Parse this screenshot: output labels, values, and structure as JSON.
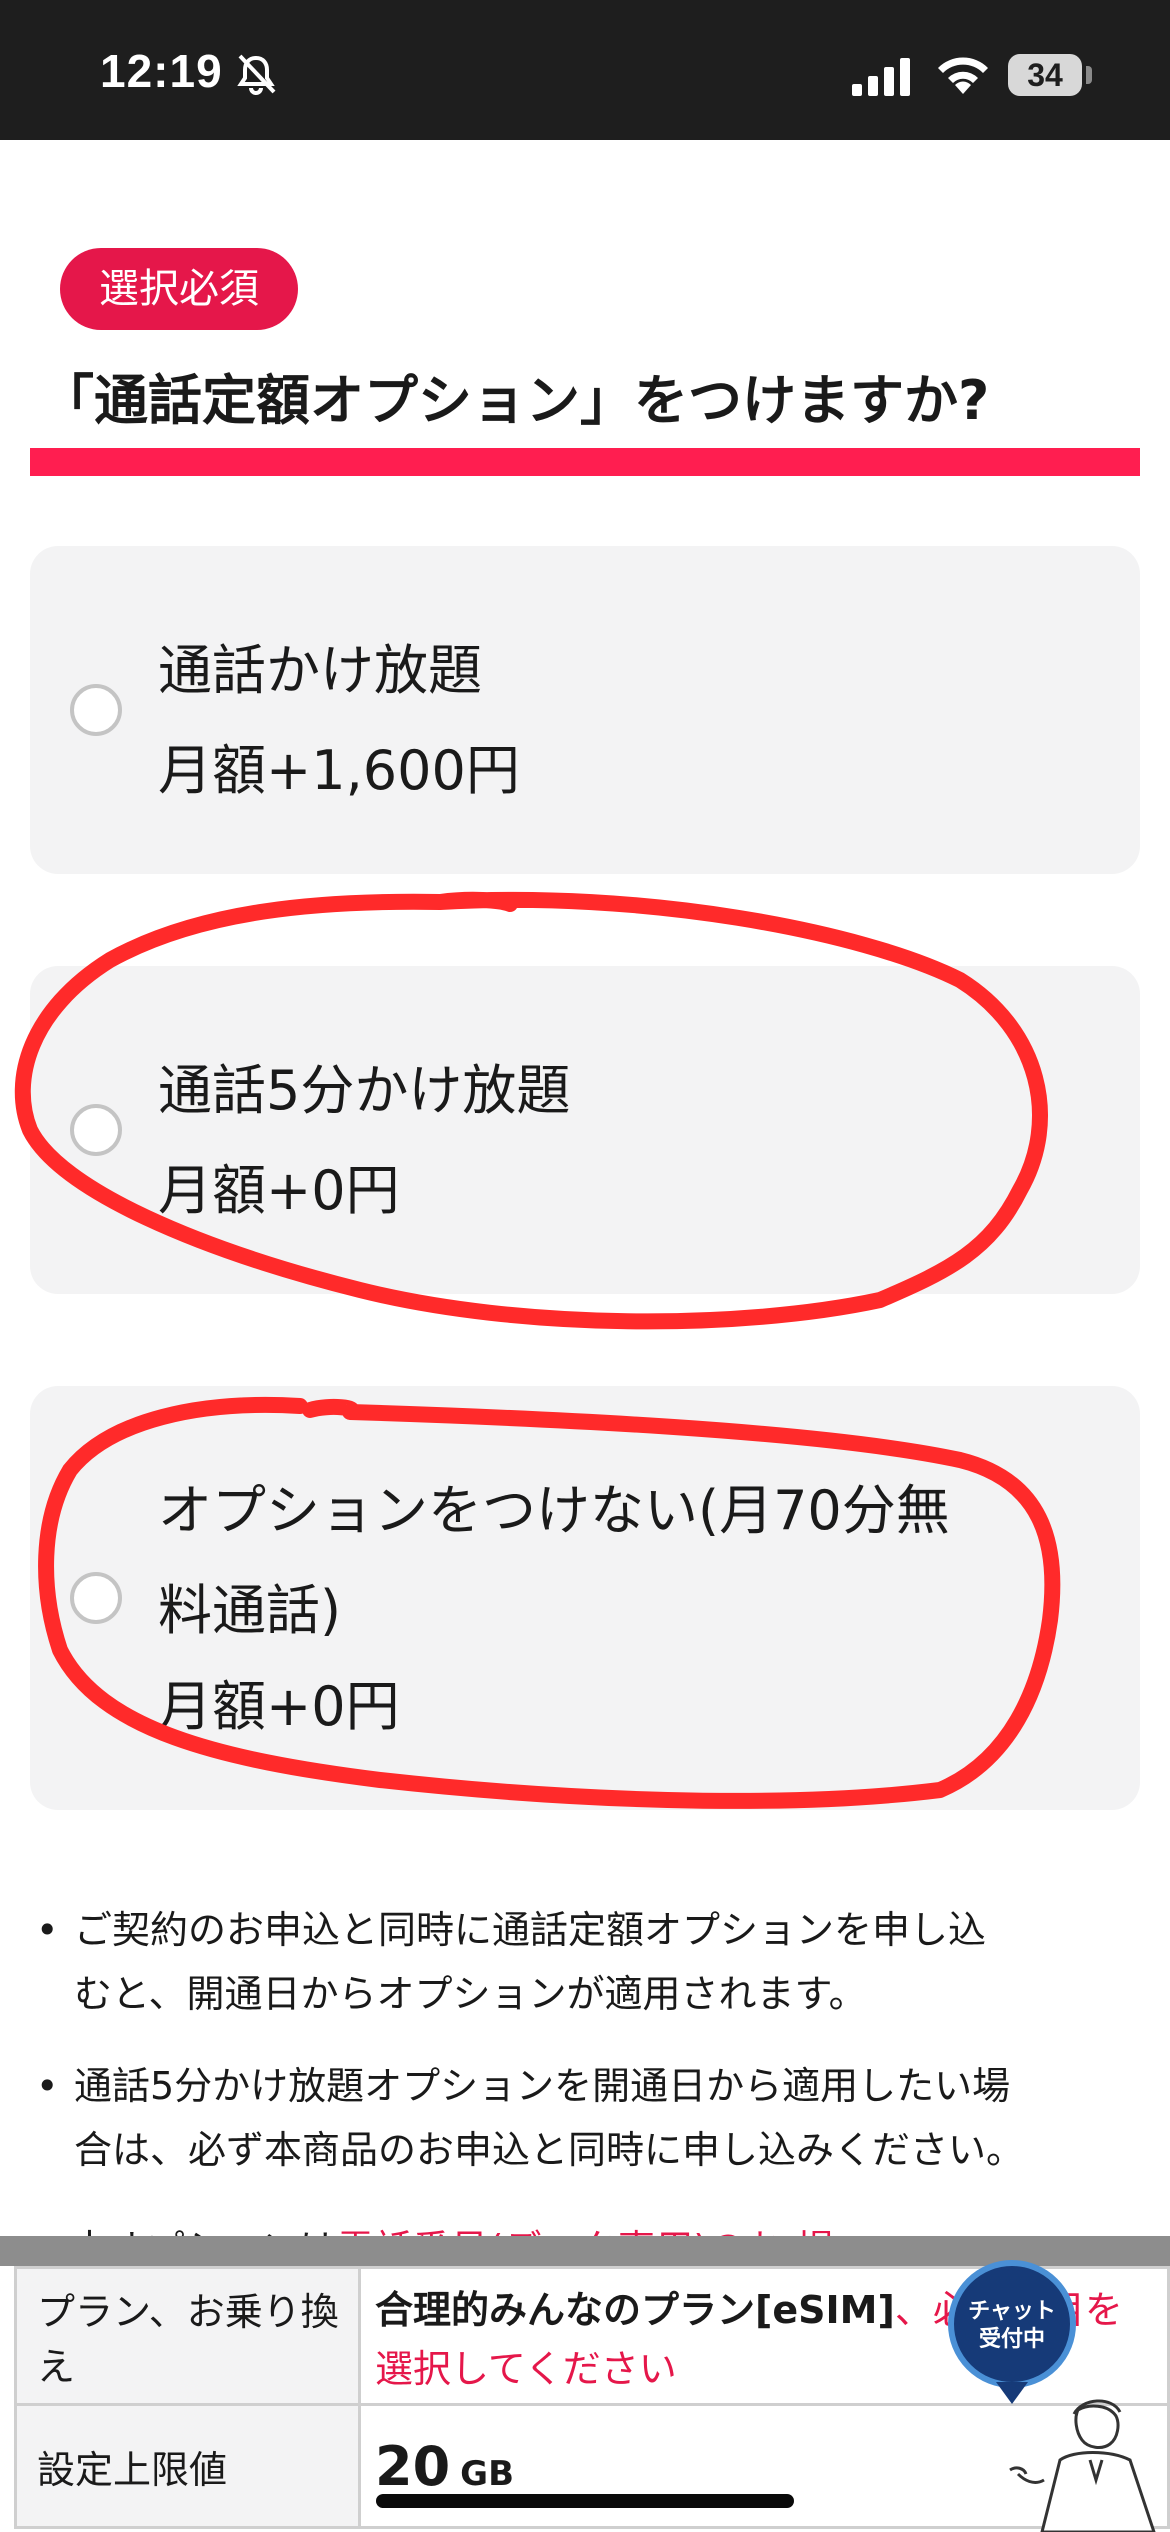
{
  "status_bar": {
    "time": "12:19",
    "battery": "34",
    "icons": [
      "bell-slash-icon",
      "signal-icon",
      "wifi-icon",
      "battery-icon"
    ]
  },
  "header": {
    "badge": "選択必須",
    "question": "「通話定額オプション」をつけますか?"
  },
  "options": [
    {
      "line1": "通話かけ放題",
      "line2": "月額+1,600円"
    },
    {
      "line1": "通話5分かけ放題",
      "line2": "月額+0円"
    },
    {
      "line1": "オプションをつけない(月70分無",
      "line1b": "料通話)",
      "line2": "月額+0円"
    }
  ],
  "notes": [
    {
      "line1": "ご契約のお申込と同時に通話定額オプションを申し込",
      "line2": "むと、開通日からオプションが適用されます。"
    },
    {
      "line1": "通話5分かけ放題オプションを開通日から適用したい場",
      "line2": "合は、必ず本商品のお申込と同時に申し込みください。"
    }
  ],
  "partial_note": {
    "start": "本オプションは",
    "link": "電話番号(データ専用)のお 場",
    "end": ""
  },
  "summary": {
    "plan_label": "プラン、お乗り換え",
    "plan_name": "合理的みんなのプラン[eSIM]",
    "plan_suffix": "、必須項目を",
    "plan_sub": "選択してください",
    "limit_label": "設定上限値",
    "limit_value": "20",
    "limit_unit": "GB"
  },
  "chat": {
    "line1": "チャット",
    "line2": "受付中"
  },
  "colors": {
    "accent": "#e5174a",
    "rule": "#ff1e50",
    "card": "#f3f3f4",
    "scribble": "#ff2a2a"
  }
}
